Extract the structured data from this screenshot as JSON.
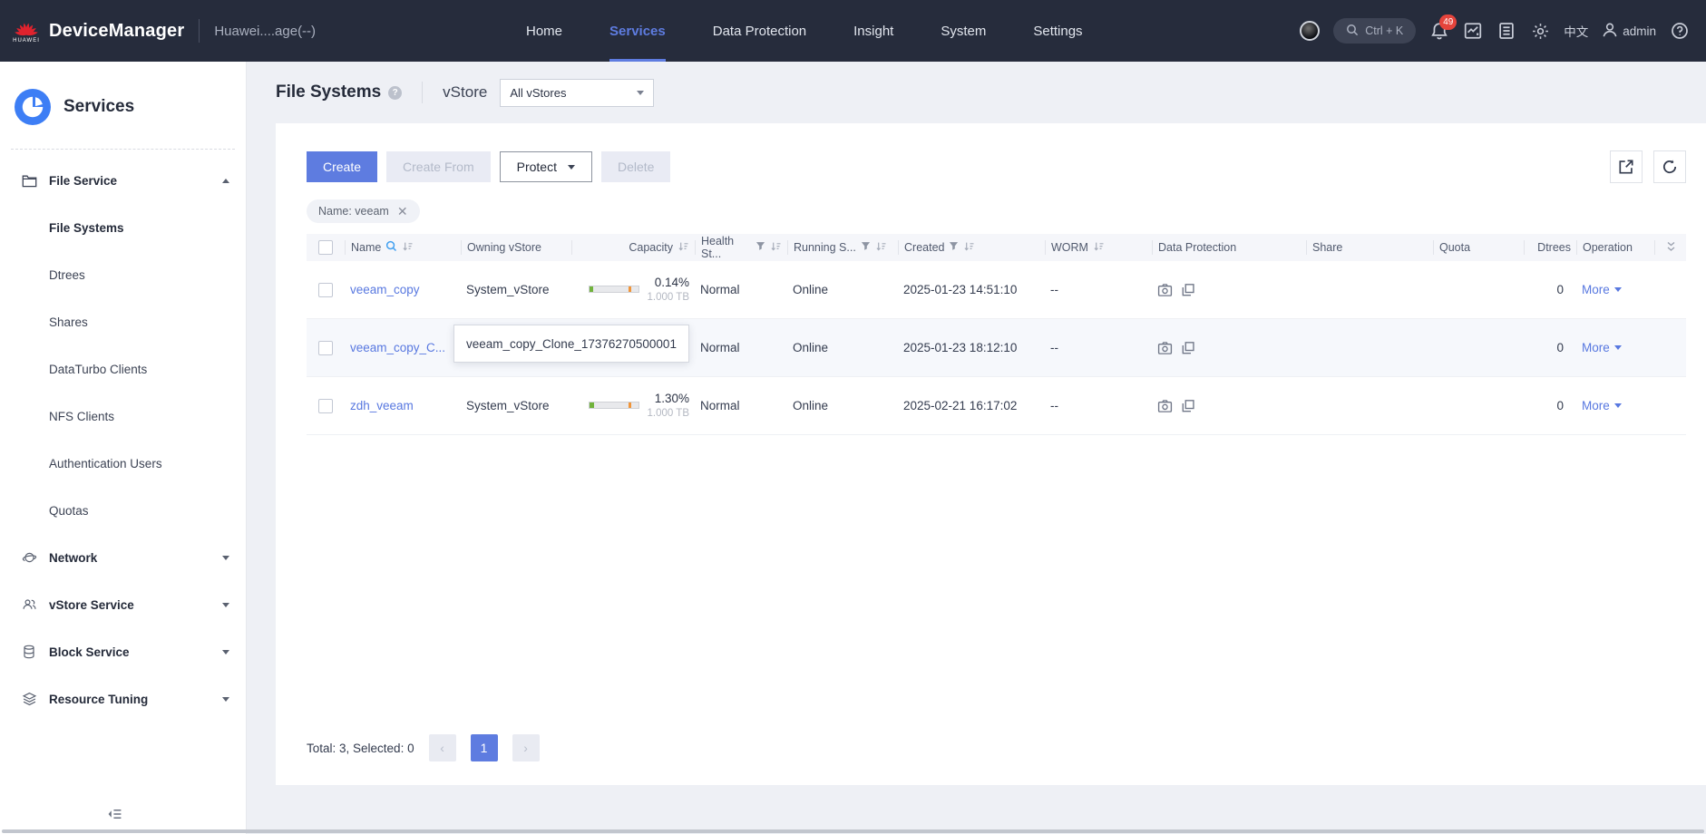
{
  "topbar": {
    "brand": "DeviceManager",
    "device_name": "Huawei....age(--)",
    "nav_items": [
      {
        "label": "Home"
      },
      {
        "label": "Services"
      },
      {
        "label": "Data Protection"
      },
      {
        "label": "Insight"
      },
      {
        "label": "System"
      },
      {
        "label": "Settings"
      }
    ],
    "search_shortcut": "Ctrl + K",
    "notification_count": "49",
    "language": "中文",
    "username": "admin"
  },
  "sidebar": {
    "title": "Services",
    "file_service_label": "File Service",
    "file_items": [
      "File Systems",
      "Dtrees",
      "Shares",
      "DataTurbo Clients",
      "NFS Clients",
      "Authentication Users",
      "Quotas"
    ],
    "groups": [
      "Network",
      "vStore Service",
      "Block Service",
      "Resource Tuning"
    ]
  },
  "page": {
    "title": "File Systems",
    "vstore_label": "vStore",
    "vstore_selected": "All vStores",
    "toolbar": {
      "create": "Create",
      "create_from": "Create From",
      "protect": "Protect",
      "delete": "Delete"
    },
    "filter_tag": "Name: veeam",
    "table": {
      "columns": {
        "name": "Name",
        "owning_vstore": "Owning vStore",
        "capacity": "Capacity",
        "health": "Health St...",
        "running": "Running S...",
        "created": "Created",
        "worm": "WORM",
        "data_protection": "Data Protection",
        "share": "Share",
        "quota": "Quota",
        "dtrees": "Dtrees",
        "operation": "Operation"
      },
      "more_label": "More",
      "rows": [
        {
          "name": "veeam_copy",
          "vstore": "System_vStore",
          "capacity_visible": true,
          "capacity_used_pct": "0.14%",
          "capacity_total": "1.000 TB",
          "health": "Normal",
          "running": "Online",
          "created": "2025-01-23 14:51:10",
          "worm": "--",
          "dtrees": "0"
        },
        {
          "name": "veeam_copy_C...",
          "vstore": "",
          "capacity_visible": false,
          "capacity_used_pct": "",
          "capacity_total": "",
          "health": "Normal",
          "running": "Online",
          "created": "2025-01-23 18:12:10",
          "worm": "--",
          "dtrees": "0"
        },
        {
          "name": "zdh_veeam",
          "vstore": "System_vStore",
          "capacity_visible": true,
          "capacity_used_pct": "1.30%",
          "capacity_total": "1.000 TB",
          "health": "Normal",
          "running": "Online",
          "created": "2025-02-21 16:17:02",
          "worm": "--",
          "dtrees": "0"
        }
      ]
    },
    "tooltip_text": "veeam_copy_Clone_17376270500001",
    "pagination": {
      "summary": "Total: 3, Selected: 0",
      "current_page": "1"
    }
  }
}
